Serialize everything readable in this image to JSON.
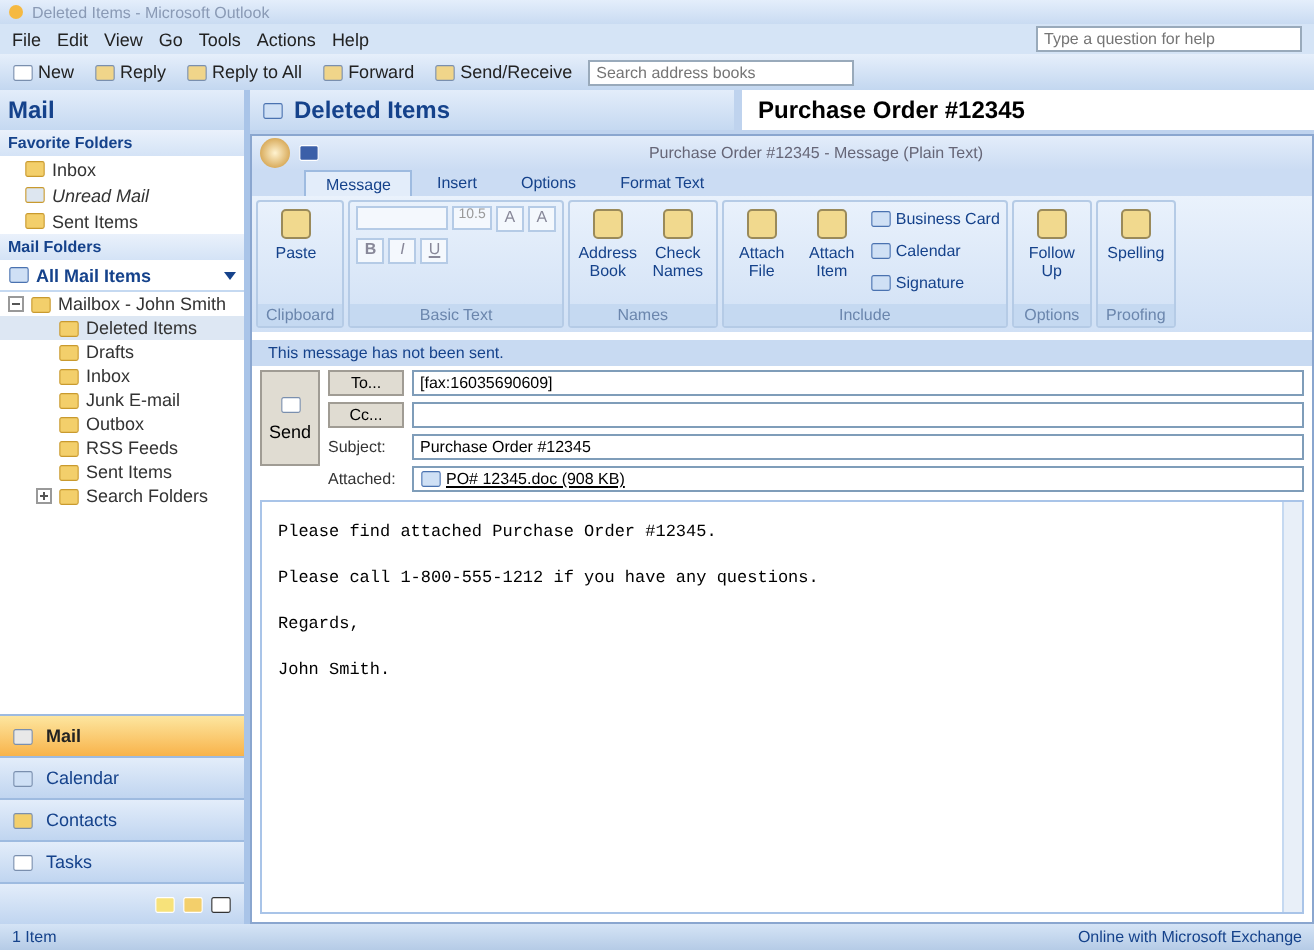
{
  "window": {
    "title": "Deleted Items - Microsoft Outlook"
  },
  "menu": [
    "File",
    "Edit",
    "View",
    "Go",
    "Tools",
    "Actions",
    "Help"
  ],
  "help_box": {
    "placeholder": "Type a question for help"
  },
  "toolbar": {
    "buttons": [
      {
        "label": "New",
        "kind": "new"
      },
      {
        "label": "Reply",
        "kind": "reply"
      },
      {
        "label": "Reply to All",
        "kind": "reply"
      },
      {
        "label": "Forward",
        "kind": "forward"
      },
      {
        "label": "Send/Receive",
        "kind": "send"
      }
    ],
    "search": {
      "placeholder": "Search address books"
    }
  },
  "navigation_pane": {
    "title": "Mail",
    "favorite_folders": {
      "title": "Favorite Folders",
      "items": [
        {
          "label": "Inbox",
          "italic": false
        },
        {
          "label": "Unread Mail",
          "italic": true
        },
        {
          "label": "Sent Items",
          "italic": false
        }
      ]
    },
    "mail_folders": {
      "title": "Mail Folders",
      "view": "All Mail Items",
      "tree": [
        {
          "label": "Mailbox - John Smith",
          "expanded": true,
          "selected": false,
          "children": [
            {
              "label": "Deleted Items",
              "selected": true
            },
            {
              "label": "Drafts",
              "selected": false
            },
            {
              "label": "Inbox",
              "selected": false
            },
            {
              "label": "Junk E-mail",
              "selected": false
            },
            {
              "label": "Outbox",
              "selected": false
            },
            {
              "label": "RSS Feeds",
              "selected": false
            },
            {
              "label": "Sent Items",
              "selected": false
            },
            {
              "label": "Search Folders",
              "selected": false,
              "expanded": false
            }
          ]
        }
      ]
    },
    "buttons": [
      {
        "label": "Mail",
        "selected": true
      },
      {
        "label": "Calendar",
        "selected": false
      },
      {
        "label": "Contacts",
        "selected": false
      },
      {
        "label": "Tasks",
        "selected": false
      }
    ]
  },
  "folder_header": {
    "title": "Deleted Items",
    "preview_title": "Purchase Order #12345"
  },
  "message_window": {
    "title": "Purchase Order #12345 - Message (Plain Text)",
    "tabs": [
      {
        "label": "Message",
        "selected": true
      },
      {
        "label": "Insert",
        "selected": false
      },
      {
        "label": "Options",
        "selected": false
      },
      {
        "label": "Format Text",
        "selected": false
      }
    ],
    "ribbon": {
      "font_size": "10.5",
      "groups": [
        {
          "title": "Clipboard",
          "buttons": [
            "Paste"
          ]
        },
        {
          "title": "Basic Text",
          "size_buttons": [
            "A",
            "A"
          ],
          "format_buttons": [
            "B",
            "I",
            "U"
          ]
        },
        {
          "title": "Names",
          "buttons": [
            "Address Book",
            "Check Names"
          ]
        },
        {
          "title": "Include",
          "buttons": [
            "Attach File",
            "Attach Item"
          ],
          "small_buttons": [
            "Business Card",
            "Calendar",
            "Signature"
          ]
        },
        {
          "title": "Options",
          "buttons": [
            "Follow Up"
          ]
        },
        {
          "title": "Proofing",
          "buttons": [
            "Spelling"
          ]
        }
      ]
    },
    "info_bar": "This message has not been sent.",
    "send_button": "Send",
    "fields": [
      {
        "label": "To...",
        "kind": "button",
        "value": "[fax:16035690609]"
      },
      {
        "label": "Cc...",
        "kind": "button"
      },
      {
        "label": "Subject:",
        "kind": "text",
        "value": "Purchase Order #12345"
      },
      {
        "label": "Attached:",
        "kind": "attachment",
        "value": "PO# 12345.doc (908 KB)"
      }
    ],
    "body": [
      "Please find attached Purchase Order #12345.",
      "Please call 1-800-555-1212 if you have any questions.",
      "Regards,",
      "John Smith."
    ]
  },
  "status_bar": {
    "left": "1 Item",
    "right": "Online with Microsoft Exchange"
  }
}
